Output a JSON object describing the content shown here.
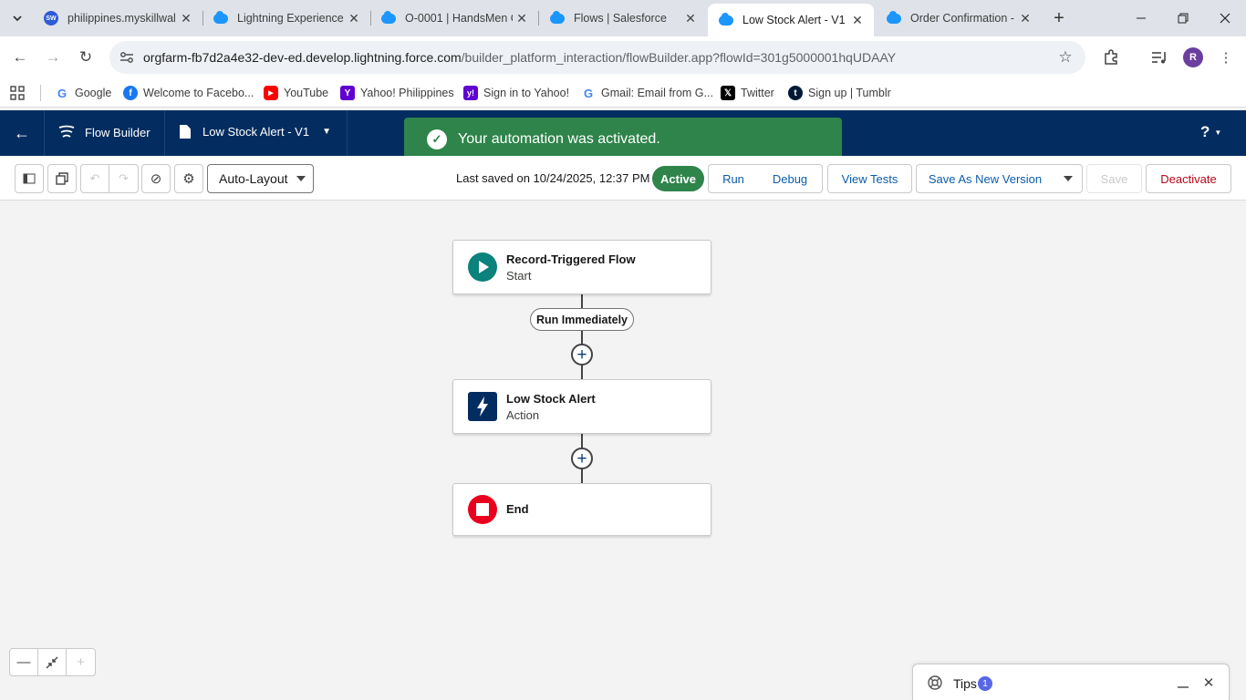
{
  "browser": {
    "tabs": [
      {
        "title": "philippines.myskillwal",
        "favicon": "skillwallet-icon"
      },
      {
        "title": "Lightning Experience",
        "favicon": "salesforce-cloud-icon"
      },
      {
        "title": "O-0001 | HandsMen C",
        "favicon": "salesforce-cloud-icon"
      },
      {
        "title": "Flows | Salesforce",
        "favicon": "salesforce-cloud-icon"
      },
      {
        "title": "Low Stock Alert - V1",
        "favicon": "salesforce-cloud-icon",
        "active": true
      },
      {
        "title": "Order Confirmation -",
        "favicon": "salesforce-cloud-icon"
      }
    ],
    "sw_badge": "SW",
    "url_host": "orgfarm-fb7d2a4e32-dev-ed.develop.lightning.force.com",
    "url_path": "/builder_platform_interaction/flowBuilder.app?flowId=301g5000001hqUDAAY",
    "profile_initial": "R",
    "bookmarks": [
      {
        "label": "Google",
        "icon": "google-icon"
      },
      {
        "label": "Welcome to Facebo...",
        "icon": "facebook-icon"
      },
      {
        "label": "YouTube",
        "icon": "youtube-icon"
      },
      {
        "label": "Yahoo! Philippines",
        "icon": "yahoo-icon"
      },
      {
        "label": "Sign in to Yahoo!",
        "icon": "yahoo-icon"
      },
      {
        "label": "Gmail: Email from G...",
        "icon": "google-icon"
      },
      {
        "label": "Twitter",
        "icon": "x-icon"
      },
      {
        "label": "Sign up | Tumblr",
        "icon": "tumblr-icon"
      }
    ]
  },
  "builder": {
    "app_name": "Flow Builder",
    "flow_label": "Low Stock Alert - V1",
    "help": "?",
    "toast": "Your automation was activated.",
    "layout_select": "Auto-Layout",
    "last_saved": "Last saved on 10/24/2025, 12:37 PM",
    "status": "Active",
    "buttons": {
      "run": "Run",
      "debug": "Debug",
      "view_tests": "View Tests",
      "save_new_version": "Save As New Version",
      "save": "Save",
      "deactivate": "Deactivate"
    },
    "colors": {
      "header": "#032d60",
      "toast": "#2e844a",
      "active": "#2e844a",
      "start": "#0b827c",
      "action": "#032d60",
      "end": "#ea001e"
    }
  },
  "flow": {
    "start": {
      "title": "Record-Triggered Flow",
      "subtitle": "Start"
    },
    "path_label": "Run Immediately",
    "action": {
      "title": "Low Stock Alert",
      "subtitle": "Action"
    },
    "end": {
      "title": "End"
    }
  },
  "tips": {
    "label": "Tips",
    "count": "1"
  }
}
